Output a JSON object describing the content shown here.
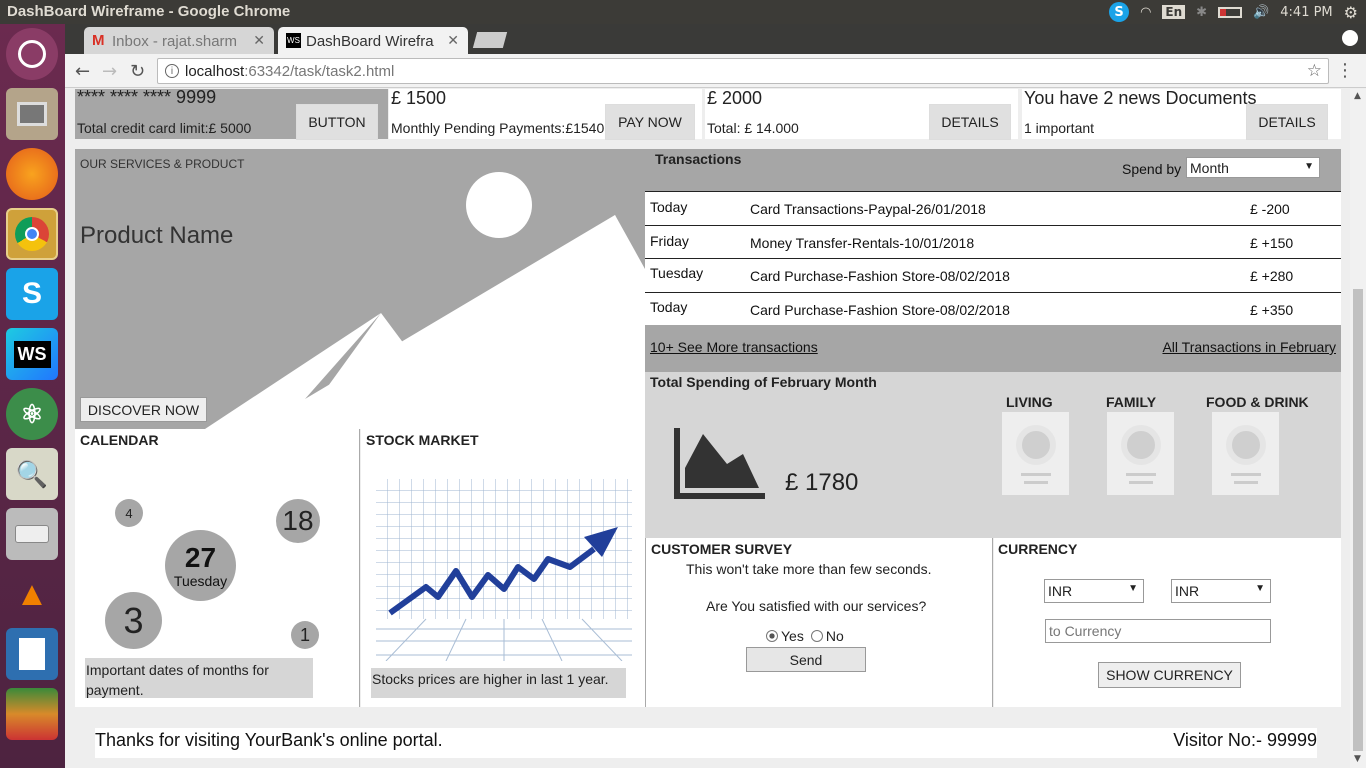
{
  "system": {
    "window_title": "DashBoard Wireframe - Google Chrome",
    "lang": "En",
    "time": "4:41 PM"
  },
  "browser": {
    "tabs": [
      {
        "label": "Inbox - rajat.sharm"
      },
      {
        "label": "DashBoard Wirefra"
      }
    ],
    "url_host": "localhost",
    "url_rest": ":63342/task/task2.html"
  },
  "cards": [
    {
      "big": "**** **** **** 9999",
      "sub": "Total credit card limit:£ 5000",
      "button": "BUTTON"
    },
    {
      "big": "£ 1500",
      "sub": "Monthly Pending Payments:£1540",
      "button": "PAY NOW"
    },
    {
      "big": "£ 2000",
      "sub": "Total: £ 14.000",
      "button": "DETAILS"
    },
    {
      "big": "You have 2 news Documents",
      "sub": "1 important",
      "button": "DETAILS"
    }
  ],
  "services": {
    "heading": "OUR SERVICES & PRODUCT",
    "product_name": "Product Name",
    "button": "DISCOVER NOW"
  },
  "transactions": {
    "heading": "Transactions",
    "spend_by_label": "Spend by",
    "spend_by_value": "Month",
    "rows": [
      {
        "day": "Today",
        "desc": "Card Transactions-Paypal-26/01/2018",
        "amount": "£ -200"
      },
      {
        "day": "Friday",
        "desc": "Money Transfer-Rentals-10/01/2018",
        "amount": "£ +150"
      },
      {
        "day": "Tuesday",
        "desc": "Card Purchase-Fashion Store-08/02/2018",
        "amount": "£ +280"
      },
      {
        "day": "Today",
        "desc": "Card Purchase-Fashion Store-08/02/2018",
        "amount": "£ +350"
      }
    ],
    "see_more": "10+ See More transactions",
    "all_link": "All Transactions in February"
  },
  "spending": {
    "heading": "Total Spending of February Month",
    "amount": "£ 1780",
    "categories": [
      "LIVING",
      "FAMILY",
      "FOOD & DRINK"
    ]
  },
  "calendar": {
    "heading": "CALENDAR",
    "day_big": "27",
    "weekday": "Tuesday",
    "dates": [
      "4",
      "18",
      "3",
      "1"
    ],
    "note": "Important dates of months for payment."
  },
  "stock": {
    "heading": "STOCK MARKET",
    "note": "Stocks prices are higher in last 1 year."
  },
  "survey": {
    "heading": "CUSTOMER SURVEY",
    "line1": "This won't take more than few seconds.",
    "question": "Are You satisfied with our services?",
    "yes": "Yes",
    "no": "No",
    "button": "Send"
  },
  "currency": {
    "heading": "CURRENCY",
    "from": "INR",
    "to": "INR",
    "placeholder": "to Currency",
    "button": "SHOW CURRENCY"
  },
  "footer": {
    "left": "Thanks for visiting YourBank's online portal.",
    "right": "Visitor No:- 99999"
  }
}
